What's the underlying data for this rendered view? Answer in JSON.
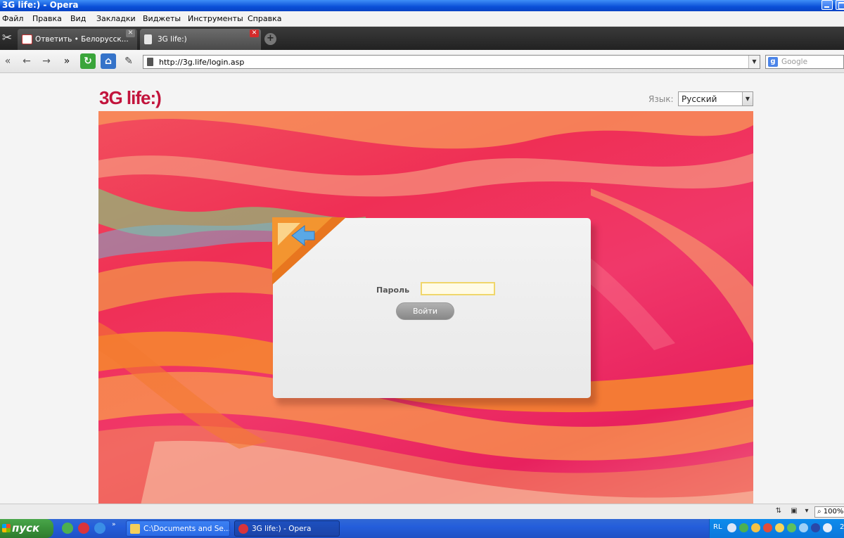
{
  "window": {
    "title": "3G life:) - Opera"
  },
  "menu": [
    "Файл",
    "Правка",
    "Вид",
    "Закладки",
    "Виджеты",
    "Инструменты",
    "Справка"
  ],
  "tabs": [
    {
      "label": "Ответить • Белорусск...",
      "active": false
    },
    {
      "label": "3G life:)",
      "active": true
    }
  ],
  "navbar": {
    "url": "http://3g.life/login.asp",
    "search_placeholder": "Google",
    "search_engine_letter": "g"
  },
  "page": {
    "logo": "3G life:)",
    "language_label": "Язык:",
    "language_value": "Русский",
    "password_label": "Пароль",
    "password_value": "",
    "login_button": "Войти"
  },
  "statusbar": {
    "zoom": "100%"
  },
  "taskbar": {
    "start": "пуск",
    "items": [
      {
        "label": "C:\\Documents and Se..."
      },
      {
        "label": "3G life:) - Opera"
      }
    ],
    "tray_lang": "RL",
    "clock": "2"
  },
  "colors": {
    "brand": "#c2143c",
    "banner_primary": "#ef2f55",
    "banner_orange": "#f7862f",
    "taskbar": "#245edb",
    "start_green": "#3a913a"
  }
}
